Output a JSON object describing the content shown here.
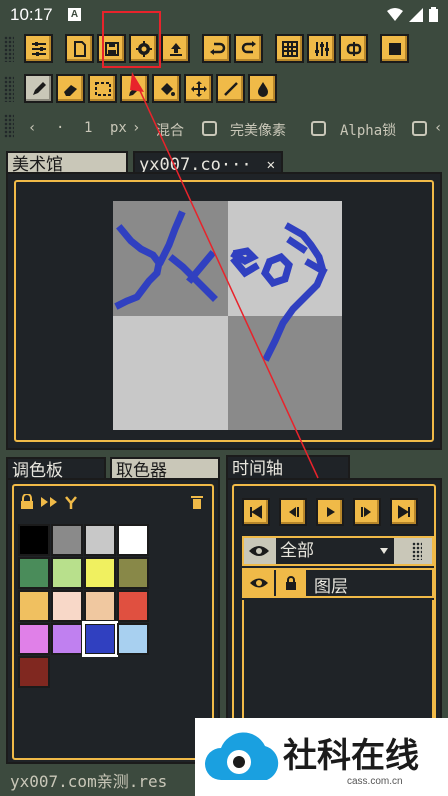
{
  "status": {
    "time": "10:17",
    "notif": "A"
  },
  "options": {
    "size_value": "1",
    "size_unit": "px",
    "blend_label": "混合",
    "perfect_label": "完美像素",
    "alpha_label": "Alpha锁"
  },
  "tabs": {
    "gallery": "美术馆",
    "file": "yx007.co···",
    "close": "✕"
  },
  "bottom_tabs": {
    "palette": "调色板",
    "picker": "取色器",
    "timeline": "时间轴"
  },
  "layers": {
    "filter": "全部",
    "layer_name": "图层"
  },
  "footer_text": "yx007.com亲测.res",
  "watermark": {
    "brand": "社科在线",
    "url": "cass.com.cn"
  },
  "palette_colors": [
    "#000000",
    "#8a8a8a",
    "#c8c8c8",
    "#ffffff",
    "#4a8c5a",
    "#b8e08c",
    "#f0f060",
    "#888848",
    "#f0c060",
    "#f8d8c8",
    "#f0c8a0",
    "#e05040",
    "#e080e8",
    "#c080f0",
    "#3040c0",
    "#a8d0f0",
    "#802820"
  ],
  "selected_color": "#3040c0"
}
